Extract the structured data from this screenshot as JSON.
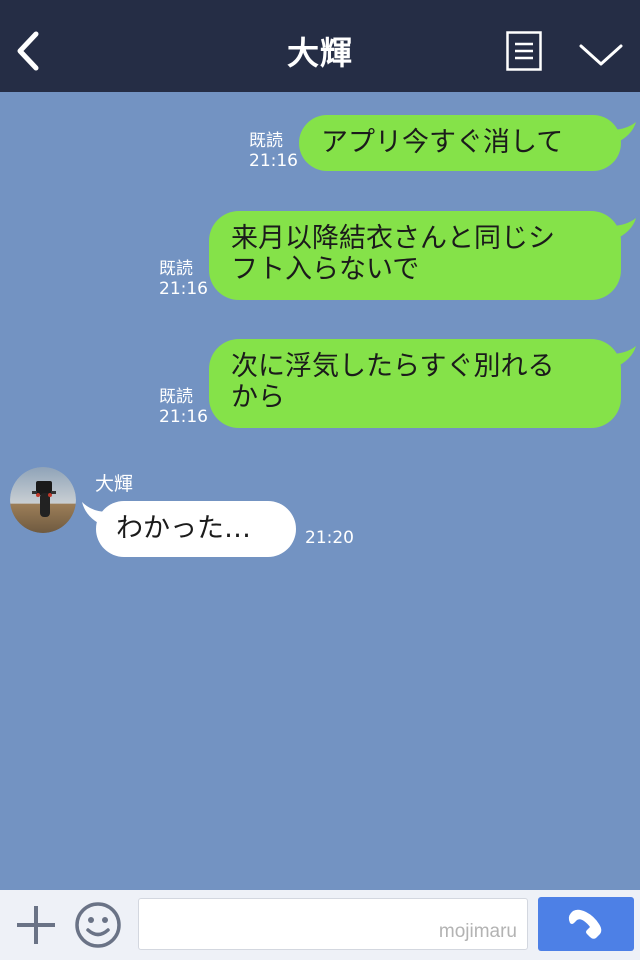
{
  "header": {
    "title": "大輝"
  },
  "messages_out": [
    {
      "text_lines": [
        "アプリ今すぐ消して"
      ],
      "read": "既読",
      "time": "21:16"
    },
    {
      "text_lines": [
        "来月以降結衣さんと同じシ",
        "フト入らないで"
      ],
      "read": "既読",
      "time": "21:16"
    },
    {
      "text_lines": [
        "次に浮気したらすぐ別れる",
        "から"
      ],
      "read": "既読",
      "time": "21:16"
    }
  ],
  "message_in": {
    "sender": "大輝",
    "text": "わかった…",
    "time": "21:20"
  },
  "footer": {
    "watermark": "mojimaru"
  },
  "colors": {
    "header": "#252d45",
    "background": "#7393c2",
    "outgoing": "#85e249",
    "incoming": "#ffffff",
    "send": "#4d80e6"
  }
}
